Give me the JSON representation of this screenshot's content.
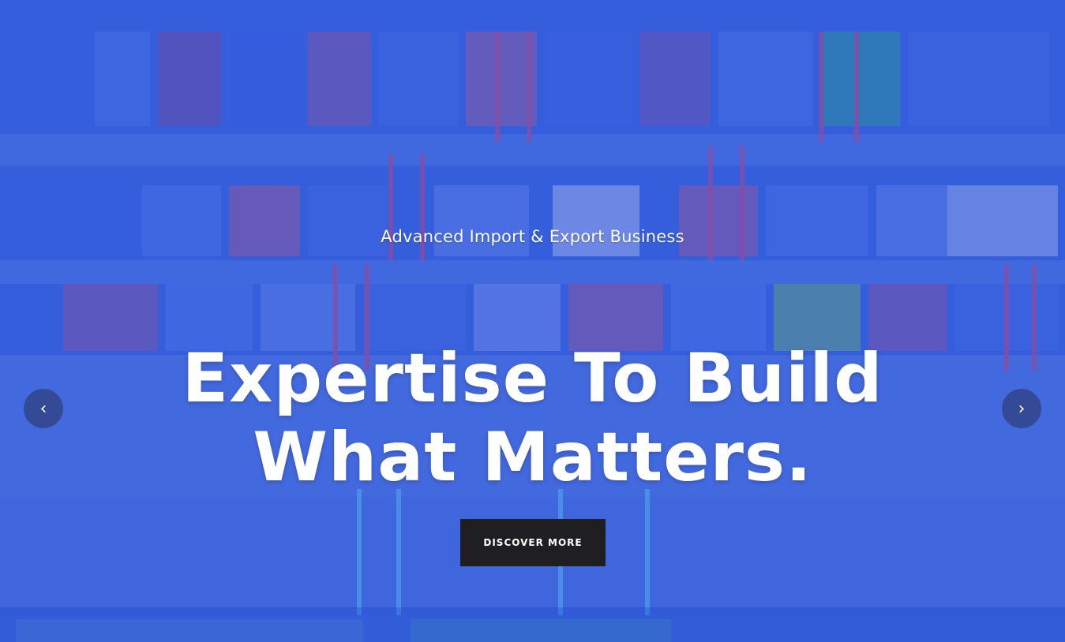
{
  "hero": {
    "subtitle": "Advanced Import & Export Business",
    "headline_line1": "Expertise To Build",
    "headline_line2": "What Matters.",
    "cta_label": "DISCOVER MORE"
  },
  "slider": {
    "prev_icon": "chevron-left-icon",
    "next_icon": "chevron-right-icon"
  },
  "colors": {
    "overlay": "#2d58e6",
    "button_bg": "#1f1f22",
    "text": "#ffffff"
  }
}
